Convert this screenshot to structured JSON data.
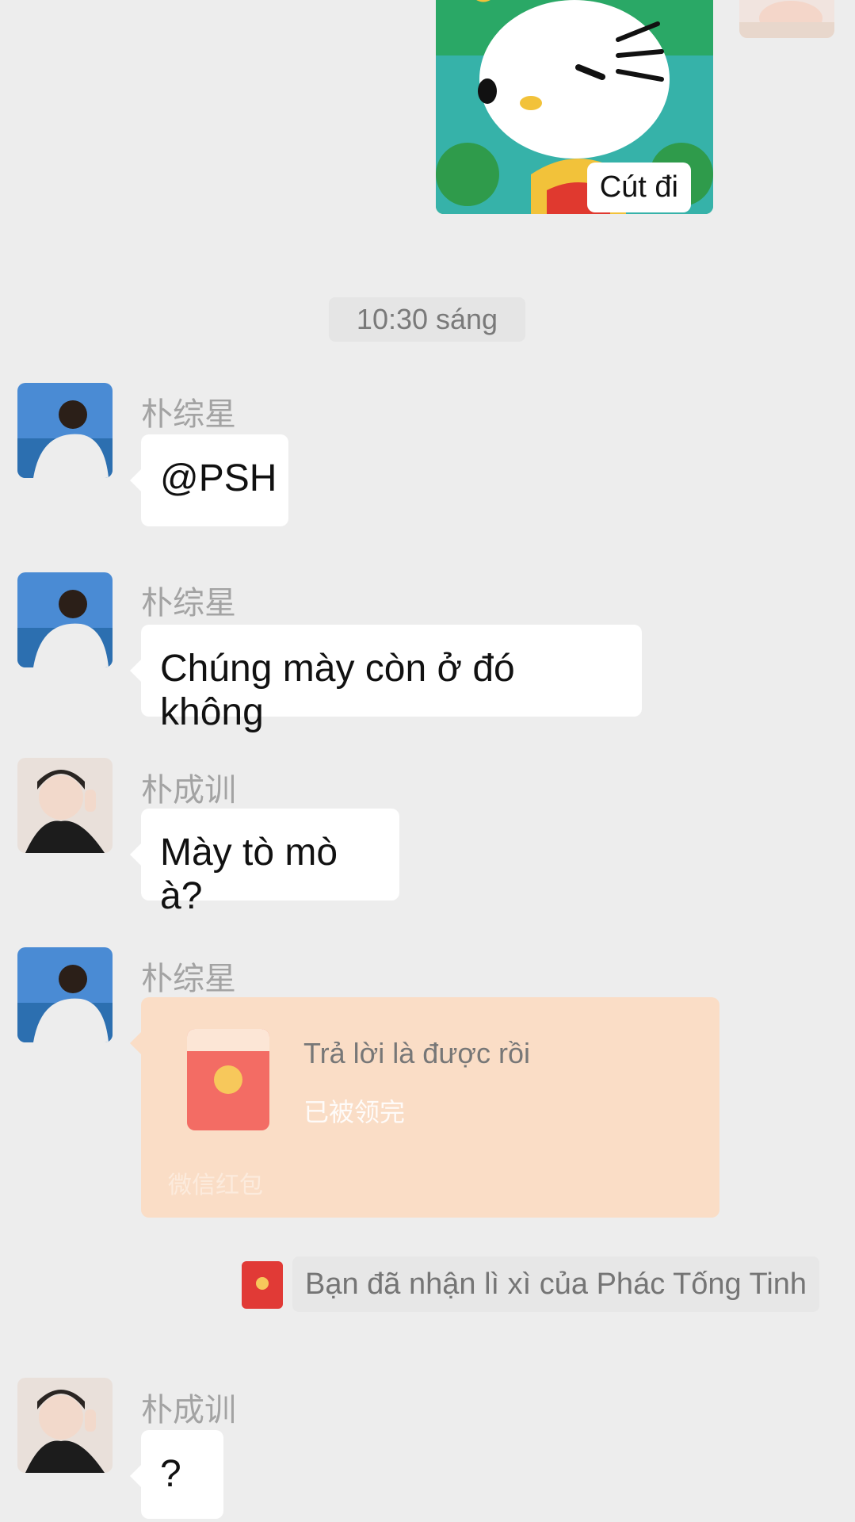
{
  "sticker": {
    "caption": "Cút đi"
  },
  "timestamp": "10:30 sáng",
  "messages": [
    {
      "sender": "朴综星",
      "text": "@PSH"
    },
    {
      "sender": "朴综星",
      "text": "Chúng mày còn ở đó không"
    },
    {
      "sender": "朴成训",
      "text": "Mày tò mò à?"
    },
    {
      "sender": "朴综星",
      "red_packet": {
        "title": "Trả lời là được rồi",
        "status": "已被领完",
        "brand": "微信红包"
      }
    },
    {
      "sender": "朴成训",
      "text": "?"
    }
  ],
  "notice": {
    "text": "Bạn đã nhận lì xì của Phác Tống Tinh"
  },
  "colors": {
    "background": "#EDEDED",
    "bubble": "#FFFFFF",
    "red_packet_bg": "#FADDC6",
    "red_packet_icon": "#F36C64",
    "name_text": "#A3A3A3"
  }
}
